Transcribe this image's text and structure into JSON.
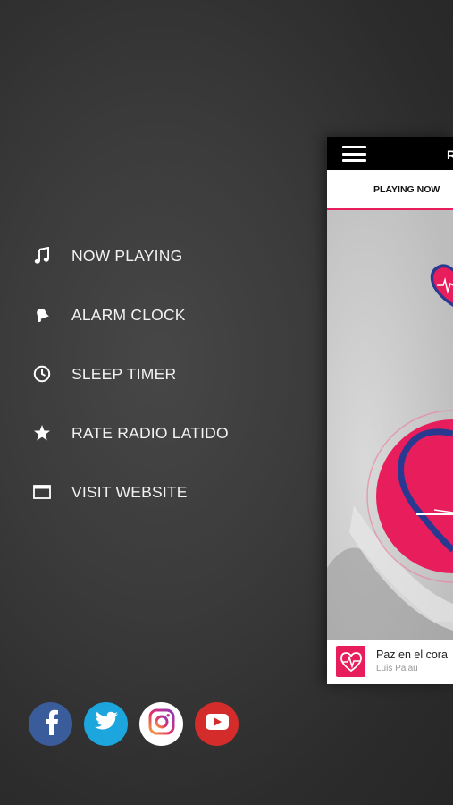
{
  "menu": {
    "items": [
      {
        "label": "NOW PLAYING",
        "icon": "music-note-icon"
      },
      {
        "label": "ALARM CLOCK",
        "icon": "bell-icon"
      },
      {
        "label": "SLEEP TIMER",
        "icon": "clock-icon"
      },
      {
        "label": "RATE RADIO LATIDO",
        "icon": "star-icon"
      },
      {
        "label": "VISIT WEBSITE",
        "icon": "browser-window-icon"
      }
    ]
  },
  "social": {
    "facebook": {
      "icon": "facebook-icon",
      "color": "#3b5c9a"
    },
    "twitter": {
      "icon": "twitter-icon",
      "color": "#1da5dd"
    },
    "instagram": {
      "icon": "instagram-icon",
      "color": "#ffffff"
    },
    "youtube": {
      "icon": "youtube-icon",
      "color": "#d42b2b"
    }
  },
  "preview": {
    "title_partial": "R",
    "tab_playing_now": "PLAYING NOW",
    "now_playing": {
      "song": "Paz en el cora",
      "artist": "Luis Palau"
    },
    "accent_color": "#e71d5c",
    "logo_blue": "#2a3990"
  }
}
